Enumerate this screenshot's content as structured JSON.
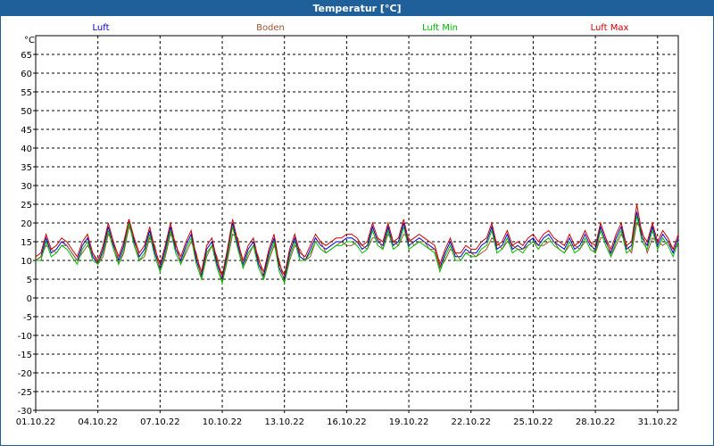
{
  "window": {
    "title": "Temperatur [°C]"
  },
  "chart_data": {
    "type": "line",
    "title": "Temperatur [°C]",
    "ylabel": "°C",
    "xlabel": "",
    "ylim": [
      -30,
      70
    ],
    "yticks": [
      -30,
      -25,
      -20,
      -15,
      -10,
      -5,
      0,
      5,
      10,
      15,
      20,
      25,
      30,
      35,
      40,
      45,
      50,
      55,
      60,
      65
    ],
    "x_tick_labels": [
      "01.10.22",
      "04.10.22",
      "07.10.22",
      "10.10.22",
      "13.10.22",
      "16.10.22",
      "19.10.22",
      "22.10.22",
      "25.10.22",
      "28.10.22",
      "31.10.22"
    ],
    "x_tick_days": [
      1,
      4,
      7,
      10,
      13,
      16,
      19,
      22,
      25,
      28,
      31
    ],
    "x_range_days": [
      1,
      32
    ],
    "grid": true,
    "legend_placement": "top",
    "x_days": [
      1.0,
      1.25,
      1.5,
      1.75,
      2.0,
      2.25,
      2.5,
      2.75,
      3.0,
      3.25,
      3.5,
      3.75,
      4.0,
      4.25,
      4.5,
      4.75,
      5.0,
      5.25,
      5.5,
      5.75,
      6.0,
      6.25,
      6.5,
      6.75,
      7.0,
      7.25,
      7.5,
      7.75,
      8.0,
      8.25,
      8.5,
      8.75,
      9.0,
      9.25,
      9.5,
      9.75,
      10.0,
      10.25,
      10.5,
      10.75,
      11.0,
      11.25,
      11.5,
      11.75,
      12.0,
      12.25,
      12.5,
      12.75,
      13.0,
      13.25,
      13.5,
      13.75,
      14.0,
      14.25,
      14.5,
      14.75,
      15.0,
      15.25,
      15.5,
      15.75,
      16.0,
      16.25,
      16.5,
      16.75,
      17.0,
      17.25,
      17.5,
      17.75,
      18.0,
      18.25,
      18.5,
      18.75,
      19.0,
      19.25,
      19.5,
      19.75,
      20.0,
      20.25,
      20.5,
      20.75,
      21.0,
      21.25,
      21.5,
      21.75,
      22.0,
      22.25,
      22.5,
      22.75,
      23.0,
      23.25,
      23.5,
      23.75,
      24.0,
      24.25,
      24.5,
      24.75,
      25.0,
      25.25,
      25.5,
      25.75,
      26.0,
      26.25,
      26.5,
      26.75,
      27.0,
      27.25,
      27.5,
      27.75,
      28.0,
      28.25,
      28.5,
      28.75,
      29.0,
      29.25,
      29.5,
      29.75,
      30.0,
      30.25,
      30.5,
      30.75,
      31.0,
      31.25,
      31.5,
      31.75,
      32.0
    ],
    "series": [
      {
        "name": "Luft",
        "color": "#0000cc",
        "values": [
          10,
          11,
          16,
          12,
          13,
          15,
          14,
          12,
          10,
          14,
          16,
          11,
          9,
          13,
          19,
          14,
          10,
          14,
          21,
          15,
          11,
          13,
          18,
          12,
          8,
          13,
          19,
          13,
          10,
          14,
          17,
          10,
          6,
          13,
          15,
          9,
          5,
          12,
          20,
          14,
          9,
          13,
          15,
          9,
          6,
          12,
          16,
          8,
          5,
          12,
          16,
          11,
          10,
          13,
          16,
          14,
          13,
          14,
          15,
          15,
          16,
          16,
          15,
          13,
          14,
          19,
          15,
          14,
          19,
          14,
          15,
          20,
          14,
          15,
          16,
          15,
          14,
          13,
          8,
          12,
          15,
          11,
          11,
          13,
          12,
          12,
          14,
          15,
          19,
          13,
          14,
          17,
          13,
          14,
          13,
          15,
          16,
          14,
          16,
          17,
          15,
          14,
          13,
          16,
          13,
          14,
          17,
          14,
          13,
          19,
          15,
          12,
          16,
          19,
          13,
          14,
          23,
          16,
          14,
          19,
          14,
          17,
          15,
          12,
          16,
          20,
          14,
          11,
          16,
          16,
          14
        ]
      },
      {
        "name": "Boden",
        "color": "#a0522d",
        "values": [
          10,
          11,
          14,
          13,
          12,
          14,
          14,
          12,
          10,
          12,
          14,
          12,
          9,
          11,
          17,
          15,
          9,
          12,
          19,
          16,
          10,
          11,
          16,
          14,
          7,
          11,
          17,
          15,
          9,
          12,
          15,
          12,
          5,
          11,
          14,
          11,
          4,
          10,
          17,
          16,
          8,
          11,
          14,
          11,
          5,
          10,
          14,
          10,
          4,
          10,
          14,
          13,
          10,
          11,
          15,
          15,
          12,
          13,
          14,
          15,
          14,
          14,
          15,
          14,
          13,
          16,
          16,
          13,
          17,
          15,
          14,
          17,
          16,
          14,
          15,
          15,
          13,
          13,
          8,
          10,
          13,
          12,
          10,
          12,
          12,
          11,
          12,
          13,
          16,
          15,
          13,
          15,
          14,
          13,
          13,
          14,
          15,
          14,
          14,
          15,
          15,
          13,
          12,
          14,
          14,
          13,
          15,
          15,
          12,
          16,
          16,
          11,
          14,
          17,
          14,
          12,
          20,
          18,
          12,
          16,
          15,
          14,
          15,
          13,
          14,
          17,
          16,
          10,
          14,
          16,
          13
        ]
      },
      {
        "name": "Luft Min",
        "color": "#00bb00",
        "values": [
          10,
          10,
          15,
          11,
          12,
          14,
          13,
          11,
          9,
          13,
          15,
          10,
          9,
          12,
          18,
          13,
          9,
          13,
          20,
          14,
          10,
          12,
          17,
          11,
          7,
          12,
          18,
          12,
          9,
          13,
          16,
          9,
          5,
          12,
          14,
          8,
          4,
          11,
          19,
          13,
          8,
          12,
          14,
          8,
          5,
          11,
          15,
          7,
          4,
          11,
          15,
          10,
          10,
          12,
          15,
          13,
          12,
          13,
          14,
          14,
          15,
          15,
          14,
          12,
          13,
          18,
          14,
          13,
          18,
          13,
          14,
          19,
          13,
          14,
          15,
          14,
          13,
          12,
          7,
          11,
          14,
          10,
          10,
          12,
          11,
          11,
          13,
          14,
          18,
          12,
          13,
          16,
          12,
          13,
          12,
          14,
          15,
          13,
          15,
          16,
          14,
          13,
          12,
          15,
          12,
          13,
          16,
          13,
          12,
          18,
          14,
          11,
          15,
          18,
          12,
          13,
          22,
          15,
          13,
          18,
          13,
          16,
          14,
          11,
          15,
          19,
          13,
          10,
          15,
          15,
          13
        ]
      },
      {
        "name": "Luft Max",
        "color": "#cc0000",
        "values": [
          11,
          12,
          17,
          13,
          14,
          16,
          15,
          13,
          11,
          15,
          17,
          12,
          10,
          14,
          20,
          15,
          11,
          15,
          21,
          16,
          12,
          14,
          19,
          13,
          9,
          14,
          20,
          14,
          11,
          15,
          18,
          11,
          7,
          14,
          16,
          10,
          6,
          13,
          21,
          15,
          10,
          14,
          16,
          10,
          7,
          13,
          17,
          9,
          6,
          13,
          17,
          12,
          11,
          14,
          17,
          15,
          14,
          15,
          16,
          16,
          17,
          17,
          16,
          14,
          15,
          20,
          16,
          15,
          20,
          15,
          16,
          21,
          15,
          16,
          17,
          16,
          15,
          14,
          9,
          13,
          16,
          12,
          12,
          14,
          13,
          13,
          15,
          16,
          20,
          14,
          15,
          18,
          14,
          15,
          14,
          16,
          17,
          15,
          17,
          18,
          16,
          15,
          14,
          17,
          14,
          15,
          18,
          15,
          14,
          20,
          16,
          13,
          17,
          20,
          14,
          15,
          25,
          17,
          15,
          20,
          15,
          18,
          16,
          13,
          17,
          21,
          15,
          12,
          17,
          17,
          15
        ]
      }
    ]
  }
}
